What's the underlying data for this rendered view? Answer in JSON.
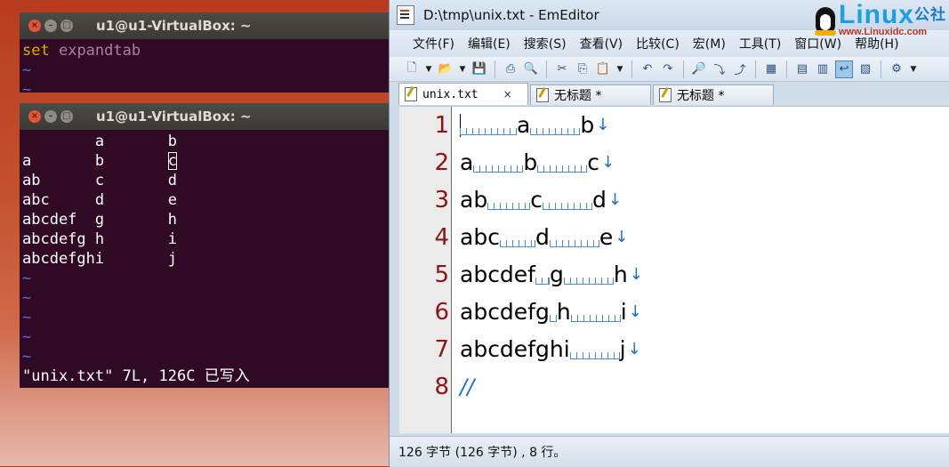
{
  "terminal1": {
    "title": "u1@u1-VirtualBox: ~",
    "keyword": "set",
    "option": "expandtab",
    "tilde": "~"
  },
  "terminal2": {
    "title": "u1@u1-VirtualBox: ~",
    "lines": [
      "        a       b",
      "a       b       c",
      "ab      c       d",
      "abc     d       e",
      "abcdef  g       h",
      "abcdefg h       i",
      "abcdefghi       j"
    ],
    "tilde": "~",
    "status": "\"unix.txt\" 7L, 126C 已写入"
  },
  "emeditor": {
    "title": "D:\\tmp\\unix.txt - EmEditor",
    "logo_text": "Linux",
    "logo_cn": "公社",
    "logo_url": "www.Linuxidc.com",
    "menu": [
      "文件(F)",
      "编辑(E)",
      "搜索(S)",
      "查看(V)",
      "比较(C)",
      "宏(M)",
      "工具(T)",
      "窗口(W)",
      "帮助(H)"
    ],
    "tabs": [
      {
        "label": "unix.txt",
        "close": "×"
      },
      {
        "label": "无标题 *"
      },
      {
        "label": "无标题 *"
      }
    ],
    "line_numbers": [
      "1",
      "2",
      "3",
      "4",
      "5",
      "6",
      "7",
      "8"
    ],
    "eol_mark": "↓",
    "eof_mark": "//",
    "status": "126 字节 (126 字节) , 8 行。",
    "colors": {
      "line_number": "#8e1414",
      "whitespace_mark": "#4a8ad6",
      "terminal_bg": "#300a24"
    }
  }
}
